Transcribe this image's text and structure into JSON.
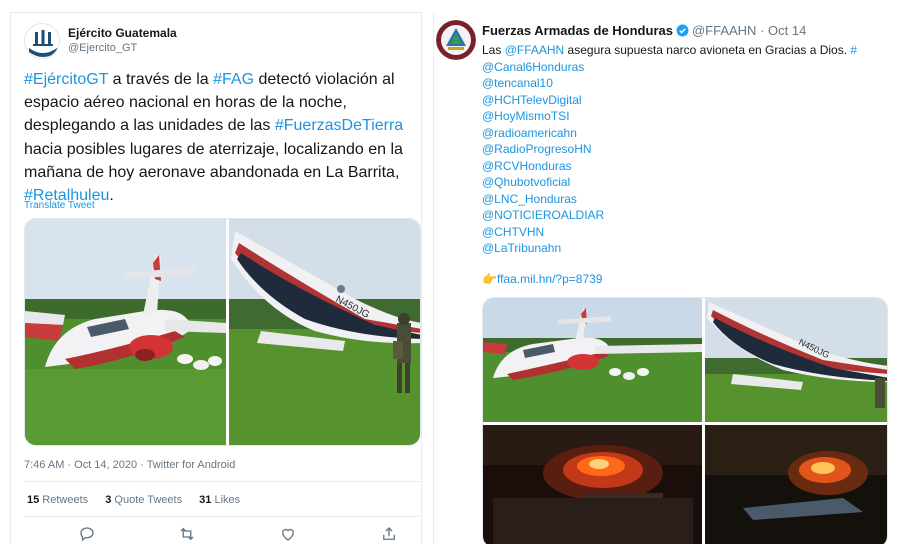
{
  "left_tweet": {
    "author_name": "Ejército Guatemala",
    "author_handle": "@Ejercito_GT",
    "text_parts": [
      {
        "type": "hashtag",
        "text": "#EjércitoGT"
      },
      {
        "type": "text",
        "text": " a través de la "
      },
      {
        "type": "hashtag",
        "text": "#FAG"
      },
      {
        "type": "text",
        "text": " detectó violación al espacio aéreo nacional en horas de la noche, desplegando a las unidades de las "
      },
      {
        "type": "hashtag",
        "text": "#FuerzasDeTierra"
      },
      {
        "type": "text",
        "text": " hacia posibles lugares de aterrizaje, localizando en la mañana de hoy aeronave abandonada en La Barrita, "
      },
      {
        "type": "hashtag",
        "text": "#Retalhuleu"
      },
      {
        "type": "text",
        "text": "."
      }
    ],
    "translate_label": "Translate Tweet",
    "meta": "7:46 AM · Oct 14, 2020 · Twitter for Android",
    "stats": {
      "retweets_count": "15",
      "retweets_label": " Retweets",
      "quotes_count": "3",
      "quotes_label": " Quote Tweets",
      "likes_count": "31",
      "likes_label": " Likes"
    },
    "aircraft_registration": "N450JG",
    "actions": [
      "reply-icon",
      "retweet-icon",
      "like-icon",
      "share-icon"
    ]
  },
  "right_tweet": {
    "author_name": "Fuerzas Armadas de Honduras",
    "author_handle": "@FFAAHN",
    "timestamp": "· Oct 14",
    "intro_prefix": "Las ",
    "intro_mention": "@FFAAHN",
    "intro_rest": " asegura supuesta narco avioneta en Gracias a Dios. ",
    "intro_trailing_hash": "#",
    "mentions": [
      "@Canal6Honduras",
      "@tencanal10",
      "@HCHTelevDigital",
      "@HoyMismoTSI",
      "@radioamericahn",
      "@RadioProgresoHN",
      "@RCVHonduras",
      "@Qhubotvoficial",
      "@LNC_Honduras",
      "@NOTICIEROALDIAR",
      "@CHTVHN",
      "@LaTribunahn"
    ],
    "link_emoji": "👉",
    "link": "ffaa.mil.hn/?p=8739",
    "aircraft_registration": "N450JG"
  },
  "colors": {
    "link_blue": "#1b95e0",
    "muted_gray": "#657786",
    "verified_blue": "#1da1f2",
    "grass_green": "#4f8f2e",
    "fire_orange": "#ff6a1a"
  }
}
